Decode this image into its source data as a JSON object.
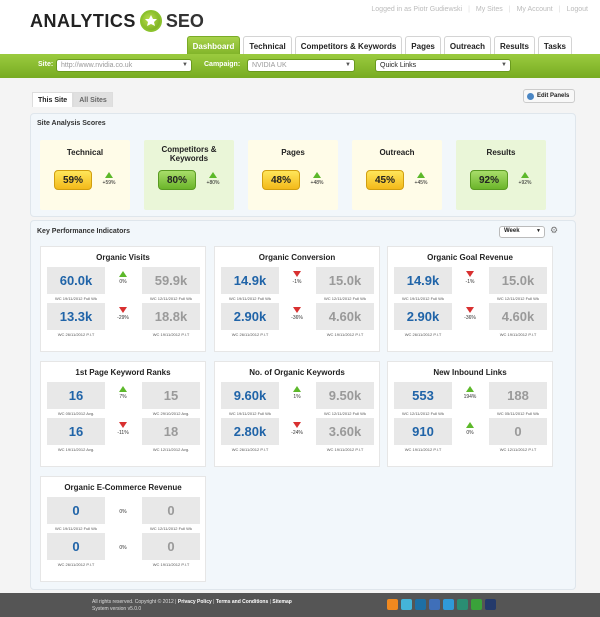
{
  "header": {
    "logo_left": "ANALYTICS",
    "logo_right": "SEO",
    "user_links": [
      "Logged in as Piotr Gudiewski",
      "My Sites",
      "My Account",
      "Logout"
    ]
  },
  "nav": {
    "tabs": [
      {
        "label": "Dashboard",
        "active": true
      },
      {
        "label": "Technical",
        "active": false
      },
      {
        "label": "Competitors & Keywords",
        "active": false
      },
      {
        "label": "Pages",
        "active": false
      },
      {
        "label": "Outreach",
        "active": false
      },
      {
        "label": "Results",
        "active": false
      },
      {
        "label": "Tasks",
        "active": false
      }
    ]
  },
  "filters": {
    "site_label": "Site:",
    "site_value": "http://www.nvidia.co.uk",
    "campaign_label": "Campaign:",
    "campaign_value": "NVIDIA UK",
    "quick_links": "Quick Links"
  },
  "subtabs": {
    "this_site": "This Site",
    "all_sites": "All Sites",
    "edit_panels": "Edit Panels"
  },
  "scores": {
    "title": "Site Analysis Scores",
    "cards": [
      {
        "title": "Technical",
        "value": "59%",
        "delta": "+59%",
        "color": "yellow"
      },
      {
        "title": "Competitors & Keywords",
        "value": "80%",
        "delta": "+80%",
        "color": "green"
      },
      {
        "title": "Pages",
        "value": "48%",
        "delta": "+48%",
        "color": "yellow"
      },
      {
        "title": "Outreach",
        "value": "45%",
        "delta": "+45%",
        "color": "yellow"
      },
      {
        "title": "Results",
        "value": "92%",
        "delta": "+92%",
        "color": "green"
      }
    ]
  },
  "kpi": {
    "title": "Key Performance Indicators",
    "period": "Week",
    "cards": [
      {
        "title": "Organic Visits",
        "row1": {
          "current": "60.0k",
          "delta": "0%",
          "dir": "up",
          "previous": "59.9k",
          "cap_current": "WC 19/11/2012 Full Wk",
          "cap_previous": "WC 12/11/2012 Full Wk"
        },
        "row2": {
          "current": "13.3k",
          "delta": "-29%",
          "dir": "down",
          "previous": "18.8k",
          "cap_current": "WC 26/11/2012 P.I.T",
          "cap_previous": "WC 19/11/2012 P.I.T"
        }
      },
      {
        "title": "Organic Conversion",
        "row1": {
          "current": "14.9k",
          "delta": "-1%",
          "dir": "down",
          "previous": "15.0k",
          "cap_current": "WC 19/11/2012 Full Wk",
          "cap_previous": "WC 12/11/2012 Full Wk"
        },
        "row2": {
          "current": "2.90k",
          "delta": "-36%",
          "dir": "down",
          "previous": "4.60k",
          "cap_current": "WC 26/11/2012 P.I.T",
          "cap_previous": "WC 19/11/2012 P.I.T"
        }
      },
      {
        "title": "Organic Goal Revenue",
        "row1": {
          "current": "14.9k",
          "delta": "-1%",
          "dir": "down",
          "previous": "15.0k",
          "cap_current": "WC 19/11/2012 Full Wk",
          "cap_previous": "WC 12/11/2012 Full Wk"
        },
        "row2": {
          "current": "2.90k",
          "delta": "-36%",
          "dir": "down",
          "previous": "4.60k",
          "cap_current": "WC 26/11/2012 P.I.T",
          "cap_previous": "WC 19/11/2012 P.I.T"
        }
      },
      {
        "title": "1st Page Keyword Ranks",
        "row1": {
          "current": "16",
          "delta": "7%",
          "dir": "up",
          "previous": "15",
          "cap_current": "WC 05/11/2012 Avg.",
          "cap_previous": "WC 29/10/2012 Avg."
        },
        "row2": {
          "current": "16",
          "delta": "-11%",
          "dir": "down",
          "previous": "18",
          "cap_current": "WC 19/11/2012 Avg.",
          "cap_previous": "WC 12/11/2012 Avg."
        }
      },
      {
        "title": "No. of Organic Keywords",
        "row1": {
          "current": "9.60k",
          "delta": "1%",
          "dir": "up",
          "previous": "9.50k",
          "cap_current": "WC 19/11/2012 Full Wk",
          "cap_previous": "WC 12/11/2012 Full Wk"
        },
        "row2": {
          "current": "2.80k",
          "delta": "-24%",
          "dir": "down",
          "previous": "3.60k",
          "cap_current": "WC 26/11/2012 P.I.T",
          "cap_previous": "WC 19/11/2012 P.I.T"
        }
      },
      {
        "title": "New Inbound Links",
        "row1": {
          "current": "553",
          "delta": "194%",
          "dir": "up",
          "previous": "188",
          "cap_current": "WC 12/11/2012 Full Wk",
          "cap_previous": "WC 05/11/2012 Full Wk"
        },
        "row2": {
          "current": "910",
          "delta": "0%",
          "dir": "up",
          "previous": "0",
          "cap_current": "WC 19/11/2012 P.I.T",
          "cap_previous": "WC 12/11/2012 P.I.T"
        }
      },
      {
        "title": "Organic E-Commerce Revenue",
        "row1": {
          "current": "0",
          "delta": "0%",
          "dir": "flat",
          "previous": "0",
          "cap_current": "WC 19/11/2012 Full Wk",
          "cap_previous": "WC 12/11/2012 Full Wk"
        },
        "row2": {
          "current": "0",
          "delta": "0%",
          "dir": "flat",
          "previous": "0",
          "cap_current": "WC 26/11/2012 P.I.T",
          "cap_previous": "WC 19/11/2012 P.I.T"
        }
      }
    ]
  },
  "footer": {
    "copyright": "All rights reserved. Copyright © 2012",
    "privacy": "Privacy Policy",
    "terms": "Terms and Conditions",
    "sitemap": "Sitemap",
    "version": "System version v5.0.0",
    "social_icons": [
      "rss-icon",
      "vimeo-icon",
      "linkedin-icon",
      "delicious-icon",
      "twitter-icon",
      "blogger-icon",
      "stumbleupon-icon",
      "facebook-icon"
    ]
  }
}
